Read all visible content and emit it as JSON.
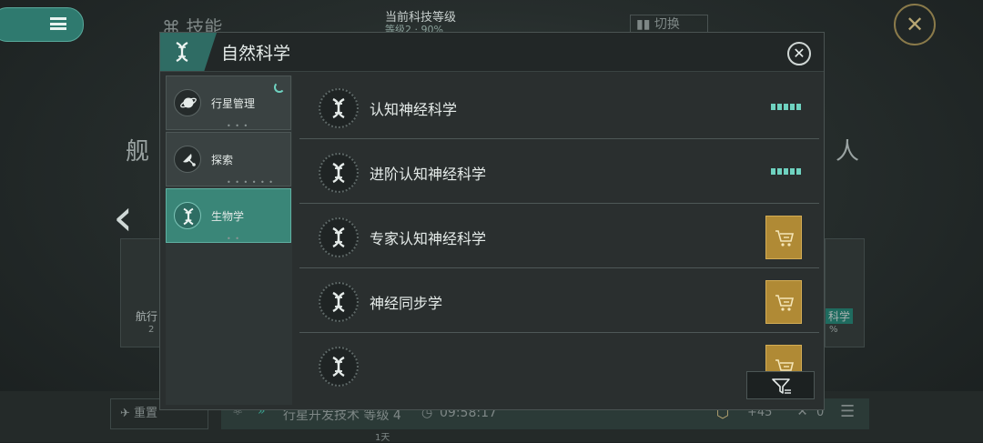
{
  "background": {
    "skills_title": "技能",
    "tech_level_label": "当前科技等级",
    "tech_level_value": "等级2 · 90%",
    "switch_label": "切换",
    "left_partial_text": "舰",
    "right_partial_text": "人",
    "card_left_label": "航行",
    "card_left_sub": "2",
    "card_right_label": "科学",
    "card_right_sub": "%",
    "bottom_left_label": "重置",
    "research_text": "行星开发技术 等级 4",
    "research_timer": "09:58:17",
    "research_days": "1天",
    "resource_value": "+45",
    "resource_count": "0"
  },
  "dialog": {
    "title": "自然科学",
    "sidebar": [
      {
        "label": "行星管理",
        "icon": "planet-icon",
        "dots": "• • •",
        "active": false,
        "loading": true
      },
      {
        "label": "探索",
        "icon": "satellite-icon",
        "dots": "• • • • • •",
        "active": false,
        "loading": false
      },
      {
        "label": "生物学",
        "icon": "dna-icon",
        "dots": "• •",
        "active": true,
        "loading": false
      }
    ],
    "techs": [
      {
        "name": "认知神经科学",
        "icon": "dna-icon",
        "level": 5,
        "purchasable": false
      },
      {
        "name": "进阶认知神经科学",
        "icon": "dna-icon",
        "level": 5,
        "purchasable": false
      },
      {
        "name": "专家认知神经科学",
        "icon": "dna-icon",
        "level": 0,
        "purchasable": true
      },
      {
        "name": "神经同步学",
        "icon": "dna-icon",
        "level": 0,
        "purchasable": true
      },
      {
        "name": "",
        "icon": "dna-icon",
        "level": 0,
        "purchasable": true
      }
    ]
  },
  "colors": {
    "accent": "#3a8678",
    "level_pip": "#6fd2c0",
    "buy_button": "#b08a35"
  }
}
